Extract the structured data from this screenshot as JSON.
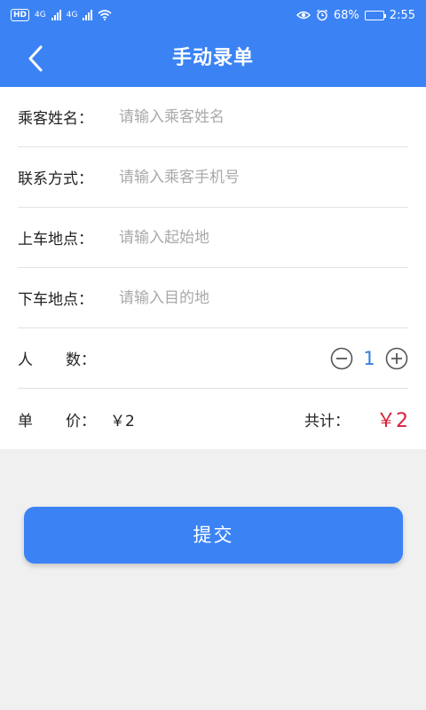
{
  "status_bar": {
    "hd_badge": "HD",
    "net1": "4G",
    "net2": "4G",
    "battery_percent": "68%",
    "battery_level": 0.68,
    "time": "2:55"
  },
  "header": {
    "title": "手动录单",
    "back_icon": "chevron-left-icon"
  },
  "form": {
    "passenger_name": {
      "label": "乘客姓名：",
      "placeholder": "请输入乘客姓名",
      "value": ""
    },
    "contact": {
      "label": "联系方式：",
      "placeholder": "请输入乘客手机号",
      "value": ""
    },
    "pickup": {
      "label": "上车地点：",
      "placeholder": "请输入起始地",
      "value": ""
    },
    "dropoff": {
      "label": "下车地点：",
      "placeholder": "请输入目的地",
      "value": ""
    },
    "count": {
      "label_a": "人",
      "label_b": "数：",
      "value": "1",
      "minus_icon": "minus-circle-icon",
      "plus_icon": "plus-circle-icon"
    },
    "price": {
      "label_a": "单",
      "label_b": "价：",
      "value": "￥2",
      "total_label": "共计：",
      "total_value": "￥2"
    }
  },
  "submit_label": "提交",
  "colors": {
    "primary": "#3b83f5",
    "accent_qty": "#2f7de1",
    "total_red": "#d8203a"
  }
}
